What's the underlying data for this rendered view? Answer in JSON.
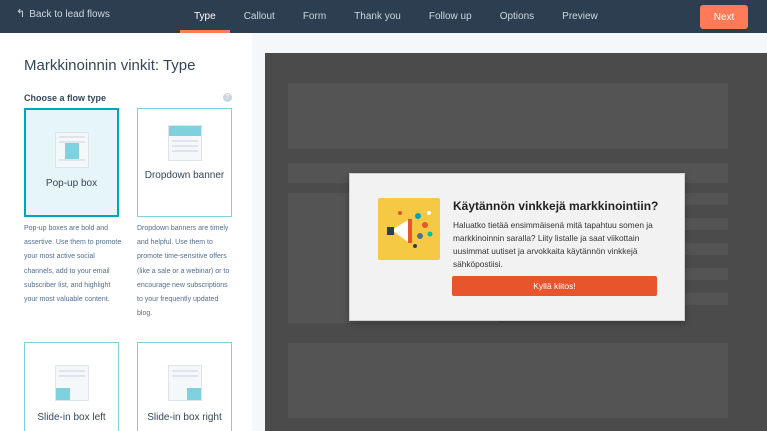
{
  "topbar": {
    "back_label": "Back to lead flows",
    "tabs": [
      {
        "label": "Type",
        "active": true
      },
      {
        "label": "Callout",
        "active": false
      },
      {
        "label": "Form",
        "active": false
      },
      {
        "label": "Thank you",
        "active": false
      },
      {
        "label": "Follow up",
        "active": false
      },
      {
        "label": "Options",
        "active": false
      },
      {
        "label": "Preview",
        "active": false
      }
    ],
    "next_label": "Next"
  },
  "left_panel": {
    "title": "Markkinoinnin vinkit: Type",
    "section_label": "Choose a flow type",
    "help_glyph": "?",
    "flow_types": [
      {
        "label": "Pop-up box",
        "selected": true,
        "description": "Pop-up boxes are bold and assertive. Use them to promote your most active social channels, add to your email subscriber list, and highlight your most valuable content."
      },
      {
        "label": "Dropdown banner",
        "selected": false,
        "description": "Dropdown banners are timely and helpful. Use them to promote time-sensitive offers (like a sale or a webinar) or to encourage new subscriptions to your frequently updated blog."
      },
      {
        "label": "Slide-in box left",
        "selected": false
      },
      {
        "label": "Slide-in box right",
        "selected": false
      }
    ]
  },
  "preview": {
    "popup": {
      "title": "Käytännön vinkkejä markkinointiin?",
      "body": "Haluatko tietää ensimmäisenä mitä tapahtuu somen ja markkinoinnin saralla? Liity listalle ja saat viikottain uusimmat uutiset ja arvokkaita käytännön vinkkejä sähköpostiisi.",
      "cta_label": "Kyllä kiitos!"
    }
  },
  "colors": {
    "topbar": "#2d3e50",
    "accent": "#ff7a59",
    "selected_border": "#00a4bd",
    "cta": "#e8542b"
  }
}
